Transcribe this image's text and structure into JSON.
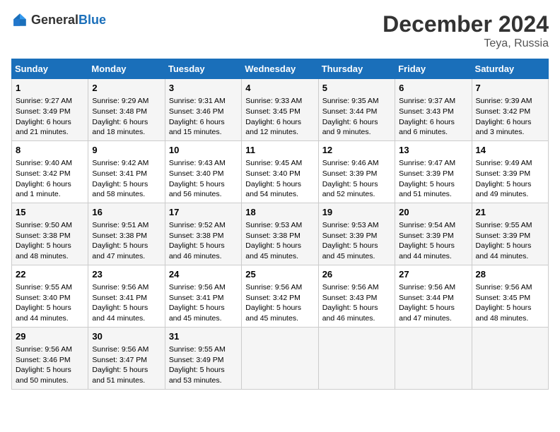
{
  "header": {
    "logo_general": "General",
    "logo_blue": "Blue",
    "title": "December 2024",
    "subtitle": "Teya, Russia"
  },
  "days_of_week": [
    "Sunday",
    "Monday",
    "Tuesday",
    "Wednesday",
    "Thursday",
    "Friday",
    "Saturday"
  ],
  "weeks": [
    [
      {
        "day": "1",
        "sunrise": "Sunrise: 9:27 AM",
        "sunset": "Sunset: 3:49 PM",
        "daylight": "Daylight: 6 hours and 21 minutes."
      },
      {
        "day": "2",
        "sunrise": "Sunrise: 9:29 AM",
        "sunset": "Sunset: 3:48 PM",
        "daylight": "Daylight: 6 hours and 18 minutes."
      },
      {
        "day": "3",
        "sunrise": "Sunrise: 9:31 AM",
        "sunset": "Sunset: 3:46 PM",
        "daylight": "Daylight: 6 hours and 15 minutes."
      },
      {
        "day": "4",
        "sunrise": "Sunrise: 9:33 AM",
        "sunset": "Sunset: 3:45 PM",
        "daylight": "Daylight: 6 hours and 12 minutes."
      },
      {
        "day": "5",
        "sunrise": "Sunrise: 9:35 AM",
        "sunset": "Sunset: 3:44 PM",
        "daylight": "Daylight: 6 hours and 9 minutes."
      },
      {
        "day": "6",
        "sunrise": "Sunrise: 9:37 AM",
        "sunset": "Sunset: 3:43 PM",
        "daylight": "Daylight: 6 hours and 6 minutes."
      },
      {
        "day": "7",
        "sunrise": "Sunrise: 9:39 AM",
        "sunset": "Sunset: 3:42 PM",
        "daylight": "Daylight: 6 hours and 3 minutes."
      }
    ],
    [
      {
        "day": "8",
        "sunrise": "Sunrise: 9:40 AM",
        "sunset": "Sunset: 3:42 PM",
        "daylight": "Daylight: 6 hours and 1 minute."
      },
      {
        "day": "9",
        "sunrise": "Sunrise: 9:42 AM",
        "sunset": "Sunset: 3:41 PM",
        "daylight": "Daylight: 5 hours and 58 minutes."
      },
      {
        "day": "10",
        "sunrise": "Sunrise: 9:43 AM",
        "sunset": "Sunset: 3:40 PM",
        "daylight": "Daylight: 5 hours and 56 minutes."
      },
      {
        "day": "11",
        "sunrise": "Sunrise: 9:45 AM",
        "sunset": "Sunset: 3:40 PM",
        "daylight": "Daylight: 5 hours and 54 minutes."
      },
      {
        "day": "12",
        "sunrise": "Sunrise: 9:46 AM",
        "sunset": "Sunset: 3:39 PM",
        "daylight": "Daylight: 5 hours and 52 minutes."
      },
      {
        "day": "13",
        "sunrise": "Sunrise: 9:47 AM",
        "sunset": "Sunset: 3:39 PM",
        "daylight": "Daylight: 5 hours and 51 minutes."
      },
      {
        "day": "14",
        "sunrise": "Sunrise: 9:49 AM",
        "sunset": "Sunset: 3:39 PM",
        "daylight": "Daylight: 5 hours and 49 minutes."
      }
    ],
    [
      {
        "day": "15",
        "sunrise": "Sunrise: 9:50 AM",
        "sunset": "Sunset: 3:38 PM",
        "daylight": "Daylight: 5 hours and 48 minutes."
      },
      {
        "day": "16",
        "sunrise": "Sunrise: 9:51 AM",
        "sunset": "Sunset: 3:38 PM",
        "daylight": "Daylight: 5 hours and 47 minutes."
      },
      {
        "day": "17",
        "sunrise": "Sunrise: 9:52 AM",
        "sunset": "Sunset: 3:38 PM",
        "daylight": "Daylight: 5 hours and 46 minutes."
      },
      {
        "day": "18",
        "sunrise": "Sunrise: 9:53 AM",
        "sunset": "Sunset: 3:38 PM",
        "daylight": "Daylight: 5 hours and 45 minutes."
      },
      {
        "day": "19",
        "sunrise": "Sunrise: 9:53 AM",
        "sunset": "Sunset: 3:39 PM",
        "daylight": "Daylight: 5 hours and 45 minutes."
      },
      {
        "day": "20",
        "sunrise": "Sunrise: 9:54 AM",
        "sunset": "Sunset: 3:39 PM",
        "daylight": "Daylight: 5 hours and 44 minutes."
      },
      {
        "day": "21",
        "sunrise": "Sunrise: 9:55 AM",
        "sunset": "Sunset: 3:39 PM",
        "daylight": "Daylight: 5 hours and 44 minutes."
      }
    ],
    [
      {
        "day": "22",
        "sunrise": "Sunrise: 9:55 AM",
        "sunset": "Sunset: 3:40 PM",
        "daylight": "Daylight: 5 hours and 44 minutes."
      },
      {
        "day": "23",
        "sunrise": "Sunrise: 9:56 AM",
        "sunset": "Sunset: 3:41 PM",
        "daylight": "Daylight: 5 hours and 44 minutes."
      },
      {
        "day": "24",
        "sunrise": "Sunrise: 9:56 AM",
        "sunset": "Sunset: 3:41 PM",
        "daylight": "Daylight: 5 hours and 45 minutes."
      },
      {
        "day": "25",
        "sunrise": "Sunrise: 9:56 AM",
        "sunset": "Sunset: 3:42 PM",
        "daylight": "Daylight: 5 hours and 45 minutes."
      },
      {
        "day": "26",
        "sunrise": "Sunrise: 9:56 AM",
        "sunset": "Sunset: 3:43 PM",
        "daylight": "Daylight: 5 hours and 46 minutes."
      },
      {
        "day": "27",
        "sunrise": "Sunrise: 9:56 AM",
        "sunset": "Sunset: 3:44 PM",
        "daylight": "Daylight: 5 hours and 47 minutes."
      },
      {
        "day": "28",
        "sunrise": "Sunrise: 9:56 AM",
        "sunset": "Sunset: 3:45 PM",
        "daylight": "Daylight: 5 hours and 48 minutes."
      }
    ],
    [
      {
        "day": "29",
        "sunrise": "Sunrise: 9:56 AM",
        "sunset": "Sunset: 3:46 PM",
        "daylight": "Daylight: 5 hours and 50 minutes."
      },
      {
        "day": "30",
        "sunrise": "Sunrise: 9:56 AM",
        "sunset": "Sunset: 3:47 PM",
        "daylight": "Daylight: 5 hours and 51 minutes."
      },
      {
        "day": "31",
        "sunrise": "Sunrise: 9:55 AM",
        "sunset": "Sunset: 3:49 PM",
        "daylight": "Daylight: 5 hours and 53 minutes."
      },
      {
        "day": "",
        "sunrise": "",
        "sunset": "",
        "daylight": ""
      },
      {
        "day": "",
        "sunrise": "",
        "sunset": "",
        "daylight": ""
      },
      {
        "day": "",
        "sunrise": "",
        "sunset": "",
        "daylight": ""
      },
      {
        "day": "",
        "sunrise": "",
        "sunset": "",
        "daylight": ""
      }
    ]
  ]
}
